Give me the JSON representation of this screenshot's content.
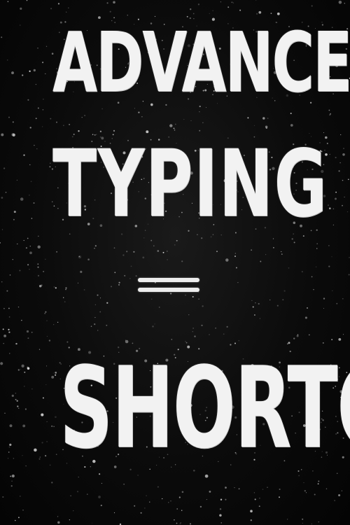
{
  "title": {
    "line1": "ADVANCED",
    "line2": "TYPING",
    "line3": "SHORTCUTS"
  },
  "colors": {
    "background": "#0b0b0b",
    "lettering": "#f2f2f2"
  }
}
